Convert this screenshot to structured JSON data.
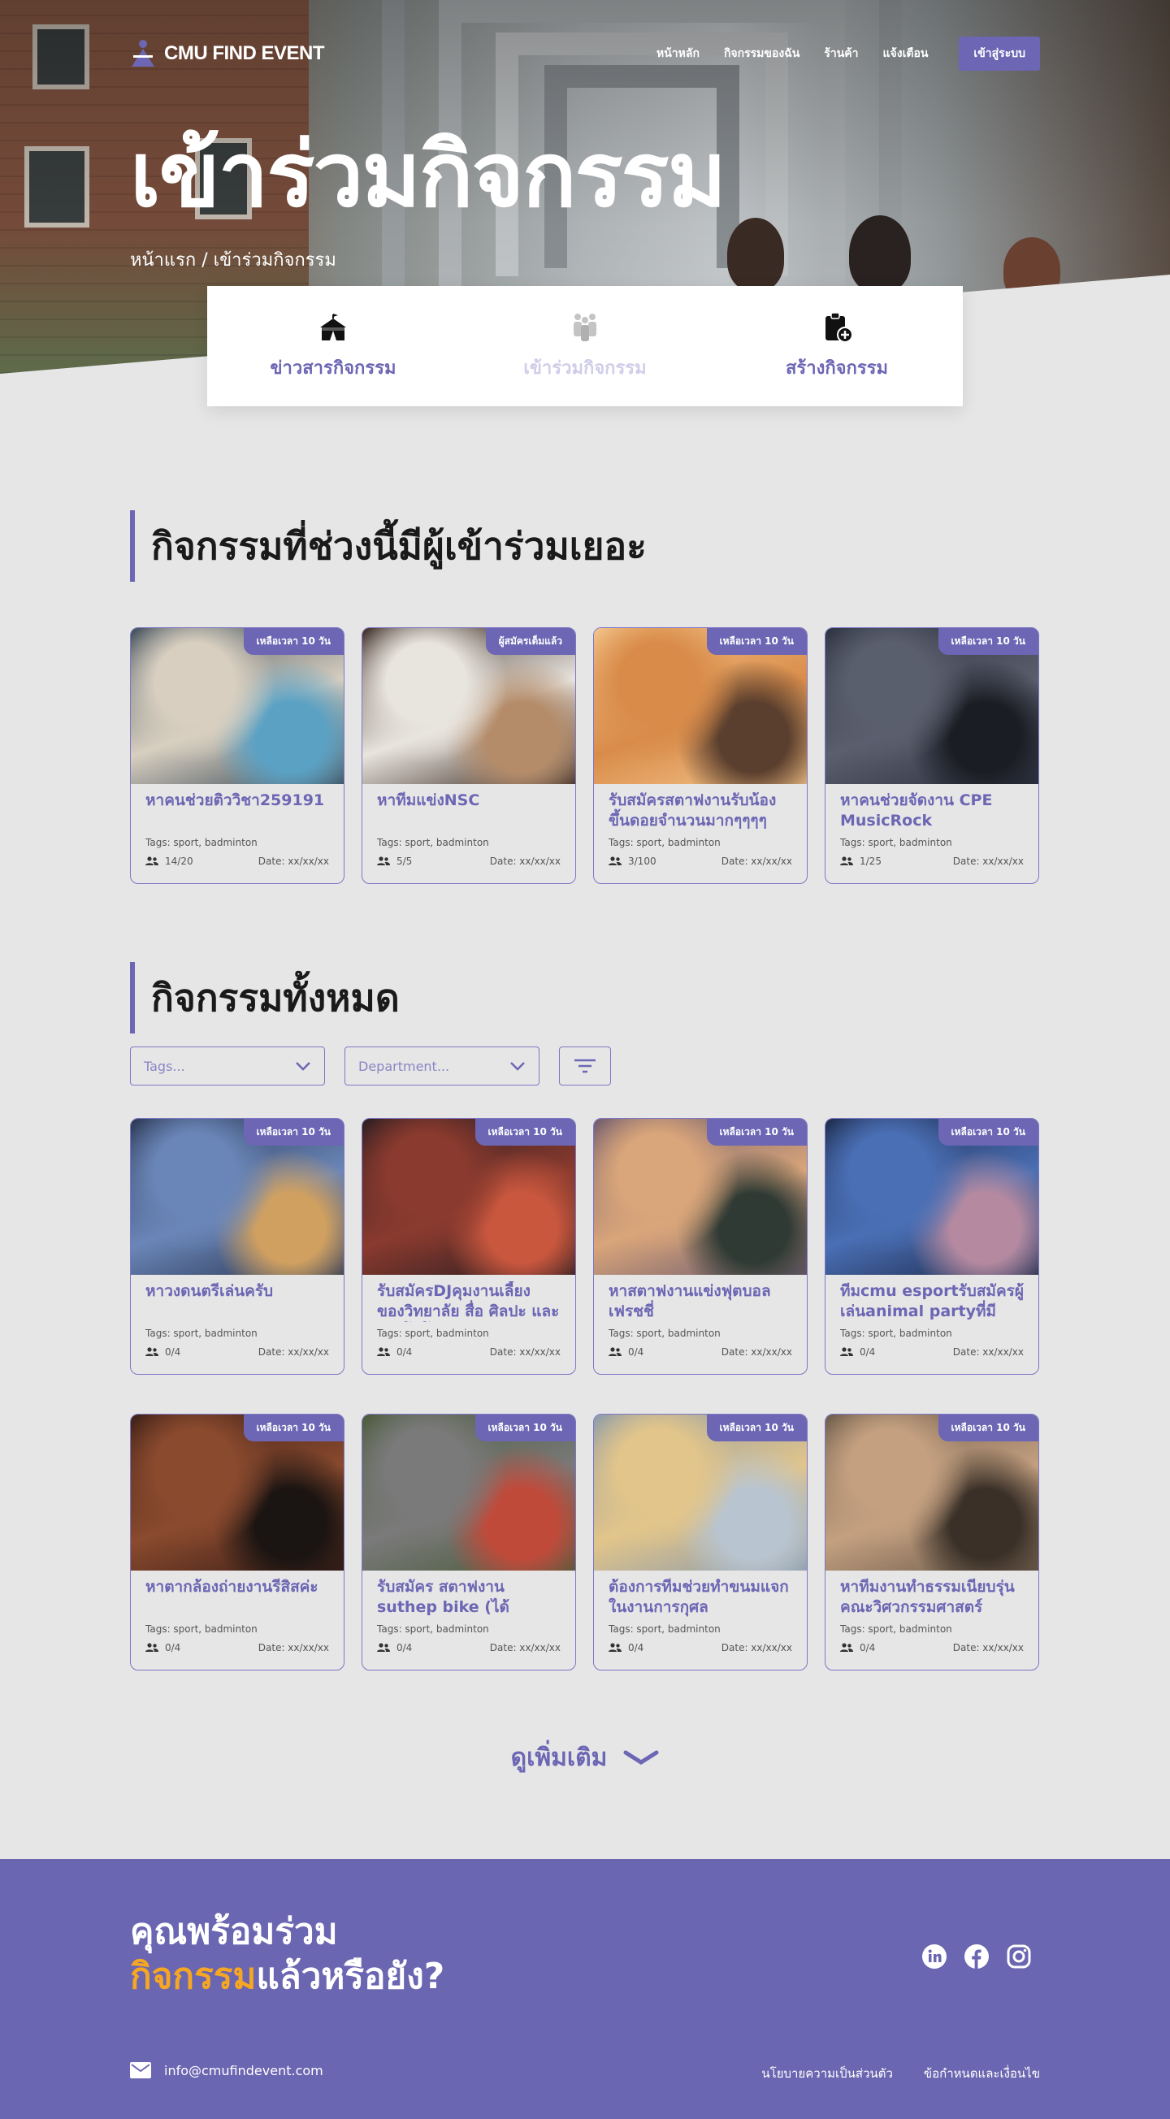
{
  "nav": {
    "logo_text": "CMU FIND EVENT",
    "links": [
      "หน้าหลัก",
      "กิจกรรมของฉัน",
      "ร้านค้า",
      "แจ้งเตือน"
    ],
    "login": "เข้าสู่ระบบ"
  },
  "hero": {
    "title": "เข้าร่วมกิจกรรม",
    "breadcrumb": "หน้าแรก / เข้าร่วมกิจกรรม"
  },
  "tabs": [
    {
      "label": "ข่าวสารกิจกรรม",
      "icon": "tent-icon",
      "active": true
    },
    {
      "label": "เข้าร่วมกิจกรรม",
      "icon": "people-icon",
      "active": false
    },
    {
      "label": "สร้างกิจกรรม",
      "icon": "clipboard-add-icon",
      "active": true
    }
  ],
  "popular": {
    "title": "กิจกรรมที่ช่วงนี้มีผู้เข้าร่วมเยอะ",
    "cards": [
      {
        "badge": "เหลือเวลา 10 วัน",
        "title": "หาคนช่วยติววิชา259191",
        "tags": "Tags: sport, badminton",
        "count": "14/20",
        "date": "Date: xx/xx/xx",
        "colors": [
          "#3b4a57",
          "#d8cfc0",
          "#5aa1c4"
        ]
      },
      {
        "badge": "ผู้สมัครเต็มแล้ว",
        "title": "หาทีมแข่งNSC",
        "tags": "Tags: sport, badminton",
        "count": "5/5",
        "date": "Date: xx/xx/xx",
        "colors": [
          "#3a2a22",
          "#e8e4de",
          "#b48c6a"
        ]
      },
      {
        "badge": "เหลือเวลา 10 วัน",
        "title": "รับสมัครสตาฟงานรับน้องขึ้นดอยจำนวนมากๆๆๆๆ",
        "tags": "Tags: sport, badminton",
        "count": "3/100",
        "date": "Date: xx/xx/xx",
        "colors": [
          "#f3c58c",
          "#d98c4a",
          "#5a3f2e"
        ]
      },
      {
        "badge": "เหลือเวลา 10 วัน",
        "title": "หาคนช่วยจัดงาน CPE MusicRock",
        "tags": "Tags: sport, badminton",
        "count": "1/25",
        "date": "Date: xx/xx/xx",
        "colors": [
          "#2c3140",
          "#5a5f6e",
          "#1b1d24"
        ]
      }
    ]
  },
  "all": {
    "title": "กิจกรรมทั้งหมด",
    "filters": {
      "tags": "Tags...",
      "department": "Department..."
    },
    "cards": [
      {
        "badge": "เหลือเวลา 10 วัน",
        "title": "หาวงดนตรีเล่นครับ",
        "tags": "Tags: sport, badminton",
        "count": "0/4",
        "date": "Date: xx/xx/xx",
        "colors": [
          "#2a3550",
          "#6a86b8",
          "#d0a060"
        ]
      },
      {
        "badge": "เหลือเวลา 10 วัน",
        "title": "รับสมัครDJคุมงานเลี้ยง ของวิทยาลัย สื่อ ศิลปะ และเทคโนโลยี",
        "tags": "Tags: sport, badminton",
        "count": "0/4",
        "date": "Date: xx/xx/xx",
        "colors": [
          "#2a1e22",
          "#8a3a2e",
          "#c9573e"
        ]
      },
      {
        "badge": "เหลือเวลา 10 วัน",
        "title": "หาสตาฟงานแข่งฟุตบอลเฟรชชี่",
        "tags": "Tags: sport, badminton",
        "count": "0/4",
        "date": "Date: xx/xx/xx",
        "colors": [
          "#6b5a6e",
          "#d9a57a",
          "#2f3a34"
        ]
      },
      {
        "badge": "เหลือเวลา 10 วัน",
        "title": "ทีมcmu esportรับสมัครผู้เล่นanimal partyที่มีทักษะ",
        "tags": "Tags: sport, badminton",
        "count": "0/4",
        "date": "Date: xx/xx/xx",
        "colors": [
          "#1d2a4a",
          "#4a6fb5",
          "#b58aa0"
        ]
      },
      {
        "badge": "เหลือเวลา 10 วัน",
        "title": "หาตากล้องถ่ายงานรีสิสค่ะ",
        "tags": "Tags: sport, badminton",
        "count": "0/4",
        "date": "Date: xx/xx/xx",
        "colors": [
          "#3a1e16",
          "#8a4a2e",
          "#1a1412"
        ]
      },
      {
        "badge": "เหลือเวลา 10 วัน",
        "title": "รับสมัคร สตาฟงาน suthep bike (ได้ชม.กยศ)",
        "tags": "Tags: sport, badminton",
        "count": "0/4",
        "date": "Date: xx/xx/xx",
        "colors": [
          "#4a5a3a",
          "#7a7a7a",
          "#c04a3a"
        ]
      },
      {
        "badge": "เหลือเวลา 10 วัน",
        "title": "ต้องการทีมช่วยทำขนมแจกในงานการกุศล",
        "tags": "Tags: sport, badminton",
        "count": "0/4",
        "date": "Date: xx/xx/xx",
        "colors": [
          "#8a9aab",
          "#e2c58a",
          "#b8c4d0"
        ]
      },
      {
        "badge": "เหลือเวลา 10 วัน",
        "title": "หาทีมงานทำธรรมเนียบรุ่นคณะวิศวกรรมศาสตร์",
        "tags": "Tags: sport, badminton",
        "count": "0/4",
        "date": "Date: xx/xx/xx",
        "colors": [
          "#6a5a4a",
          "#c4a080",
          "#3a3028"
        ]
      }
    ]
  },
  "more": "ดูเพิ่มเติม",
  "footer": {
    "line1": "คุณพร้อมร่วม",
    "accent": "กิจกรรม",
    "line2_rest": "แล้วหรือยัง?",
    "email": "info@cmufindevent.com",
    "links": [
      "นโยบายความเป็นส่วนตัว",
      "ข้อกำหนดและเงื่อนไข"
    ],
    "accent_color": "#f5a623",
    "brand_color": "#6c66b4"
  }
}
